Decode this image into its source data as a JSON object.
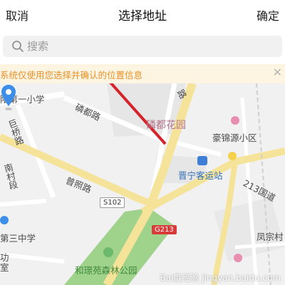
{
  "header": {
    "cancel_label": "取消",
    "title": "选择地址",
    "confirm_label": "确定"
  },
  "search": {
    "placeholder": "搜索",
    "value": ""
  },
  "notice": {
    "text": "系统仅使用您选择并确认的位置信息",
    "close_icon": "close-icon"
  },
  "map": {
    "labels": {
      "school1": "阳第一小学",
      "road_lindu": "磷都路",
      "lindu_garden": "磷都花园",
      "haojin": "豪锦源小区",
      "jujing": "巨桥路",
      "nancun": "南村段",
      "puzhao": "普照路",
      "jinning_bus": "晋宁客运站",
      "national_road": "213国道",
      "school3": "第三中学",
      "gong": "功室",
      "heyuan_park": "和璟苑森林公园",
      "fengzong": "凤宗村",
      "road_top": "路"
    },
    "signs": {
      "s102": "S102",
      "g213": "G213"
    },
    "colors": {
      "map_bg": "#f1f1f1",
      "road_yellow": "#f6e39a",
      "road_white": "#ffffff",
      "park_green": "#9fd28a",
      "block_gray": "#e4e4e4",
      "marker_blue": "#3d8ee8",
      "arrow_red": "#d4232a"
    }
  },
  "watermark": "Bai度经验 jingyan.baidu.com"
}
